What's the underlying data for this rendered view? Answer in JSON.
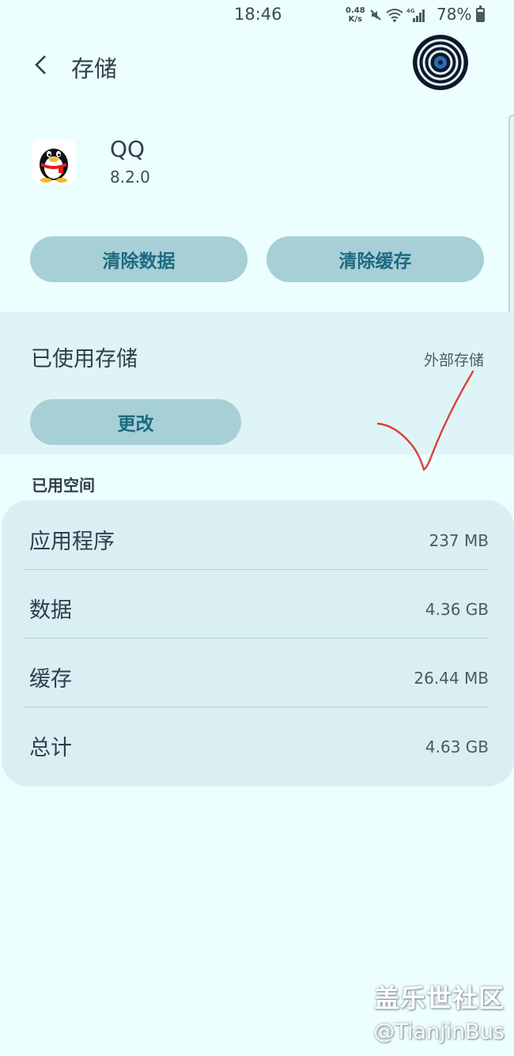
{
  "status_bar": {
    "time": "18:46",
    "net_speed_value": "0.48",
    "net_speed_unit": "K/s",
    "icons": [
      "mute-icon",
      "wifi-icon",
      "4g-signal-icon"
    ],
    "network_type": "4G",
    "battery": "78%",
    "battery_level": 0.78
  },
  "header": {
    "title": "存储"
  },
  "app": {
    "name": "QQ",
    "version": "8.2.0"
  },
  "actions": {
    "clear_data": "清除数据",
    "clear_cache": "清除缓存"
  },
  "storage": {
    "label": "已使用存储",
    "location": "外部存储",
    "change": "更改"
  },
  "space_used": {
    "header": "已用空间",
    "rows": [
      {
        "label": "应用程序",
        "value": "237 MB"
      },
      {
        "label": "数据",
        "value": "4.36 GB"
      },
      {
        "label": "缓存",
        "value": "26.44 MB"
      },
      {
        "label": "总计",
        "value": "4.63 GB"
      }
    ]
  },
  "watermark": {
    "line1": "盖乐世社区",
    "line2": "@TianjinBus"
  },
  "colors": {
    "background": "#ecfefe",
    "button": "#a6cfd6",
    "button_text": "#1c6a80",
    "section": "#dff4f6",
    "card": "#d9eff3",
    "annotation": "#d9403a"
  }
}
